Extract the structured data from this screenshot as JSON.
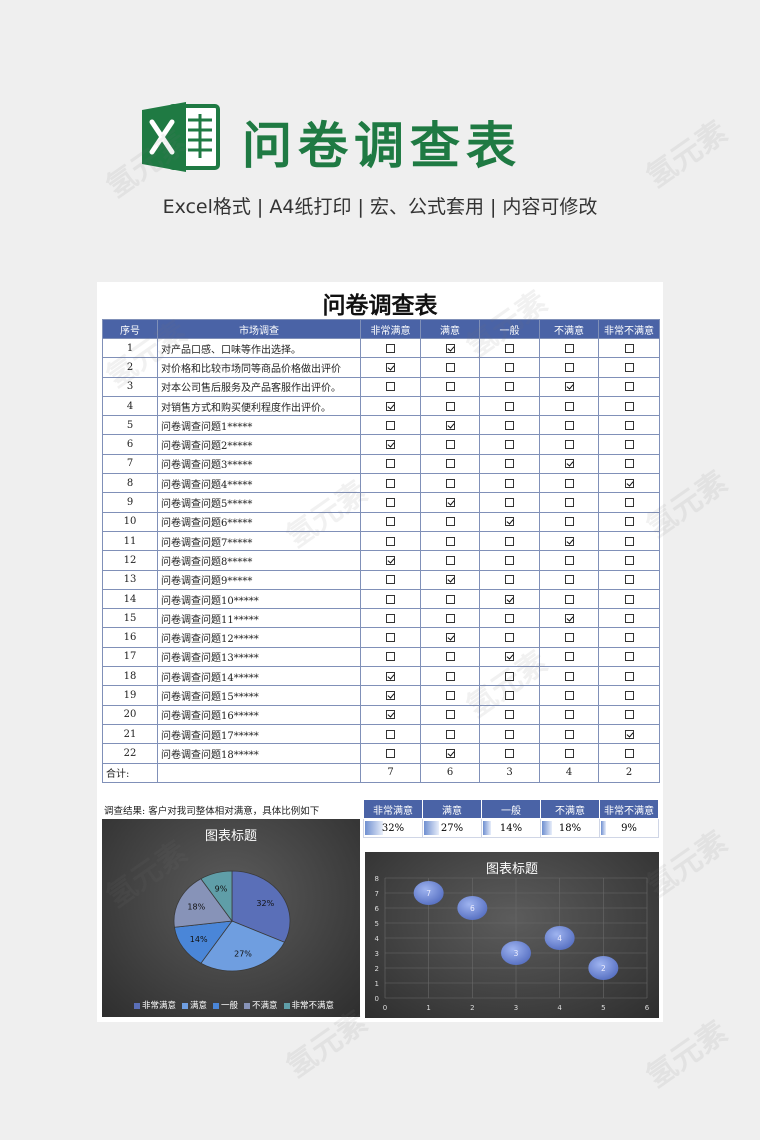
{
  "hero": {
    "title": "问卷调查表",
    "subtitle": "Excel格式 |  A4纸打印 | 宏、公式套用 | 内容可修改",
    "brand_color": "#1f7a43",
    "watermark": "氢元素"
  },
  "sheet": {
    "title": "问卷调查表",
    "headers": [
      "序号",
      "市场调查",
      "非常满意",
      "满意",
      "一般",
      "不满意",
      "非常不满意"
    ],
    "rows": [
      {
        "no": "1",
        "q": "对产品口感、口味等作出选择。",
        "sel": 1
      },
      {
        "no": "2",
        "q": "对价格和比较市场同等商品价格做出评价",
        "sel": 0
      },
      {
        "no": "3",
        "q": "对本公司售后服务及产品客服作出评价。",
        "sel": 3
      },
      {
        "no": "4",
        "q": "对销售方式和购买便利程度作出评价。",
        "sel": 0
      },
      {
        "no": "5",
        "q": "问卷调查问题1*****",
        "sel": 1
      },
      {
        "no": "6",
        "q": "问卷调查问题2*****",
        "sel": 0
      },
      {
        "no": "7",
        "q": "问卷调查问题3*****",
        "sel": 3
      },
      {
        "no": "8",
        "q": "问卷调查问题4*****",
        "sel": 4
      },
      {
        "no": "9",
        "q": "问卷调查问题5*****",
        "sel": 1
      },
      {
        "no": "10",
        "q": "问卷调查问题6*****",
        "sel": 2
      },
      {
        "no": "11",
        "q": "问卷调查问题7*****",
        "sel": 3
      },
      {
        "no": "12",
        "q": "问卷调查问题8*****",
        "sel": 0
      },
      {
        "no": "13",
        "q": "问卷调查问题9*****",
        "sel": 1
      },
      {
        "no": "14",
        "q": "问卷调查问题10*****",
        "sel": 2
      },
      {
        "no": "15",
        "q": "问卷调查问题11*****",
        "sel": 3
      },
      {
        "no": "16",
        "q": "问卷调查问题12*****",
        "sel": 1
      },
      {
        "no": "17",
        "q": "问卷调查问题13*****",
        "sel": 2
      },
      {
        "no": "18",
        "q": "问卷调查问题14*****",
        "sel": 0
      },
      {
        "no": "19",
        "q": "问卷调查问题15*****",
        "sel": 0
      },
      {
        "no": "20",
        "q": "问卷调查问题16*****",
        "sel": 0
      },
      {
        "no": "21",
        "q": "问卷调查问题17*****",
        "sel": 4
      },
      {
        "no": "22",
        "q": "问卷调查问题18*****",
        "sel": 1
      }
    ],
    "total_label": "合计:",
    "totals": [
      "7",
      "6",
      "3",
      "4",
      "2"
    ],
    "result_label": "调查结果:   客户对我司整体相对满意，具体比例如下",
    "percent_headers": [
      "非常满意",
      "满意",
      "一般",
      "不满意",
      "非常不满意"
    ],
    "percents": [
      "32%",
      "27%",
      "14%",
      "18%",
      "9%"
    ],
    "percent_values": [
      0.32,
      0.27,
      0.14,
      0.18,
      0.09
    ]
  },
  "chart_data": [
    {
      "type": "pie",
      "title": "图表标题",
      "categories": [
        "非常满意",
        "满意",
        "一般",
        "不满意",
        "非常不满意"
      ],
      "values": [
        32,
        27,
        14,
        18,
        9
      ],
      "labels": [
        "32%",
        "27%",
        "14%",
        "18%",
        "9%"
      ],
      "colors": [
        "#5a6fb8",
        "#6f9ee0",
        "#4a86d8",
        "#8793b8",
        "#5f9ea8"
      ],
      "legend": "bottom"
    },
    {
      "type": "scatter",
      "subtype": "bubble",
      "title": "图表标题",
      "x": [
        1,
        2,
        3,
        4,
        5
      ],
      "y": [
        7,
        6,
        3,
        4,
        2
      ],
      "labels": [
        "7",
        "6",
        "3",
        "4",
        "2"
      ],
      "xlim": [
        0,
        6
      ],
      "ylim": [
        0,
        8
      ],
      "xticks": [
        "0",
        "1",
        "2",
        "3",
        "4",
        "5",
        "6"
      ],
      "yticks": [
        "0",
        "1",
        "2",
        "3",
        "4",
        "5",
        "6",
        "7",
        "8"
      ],
      "grid": true,
      "color": "#5a73c4"
    }
  ]
}
